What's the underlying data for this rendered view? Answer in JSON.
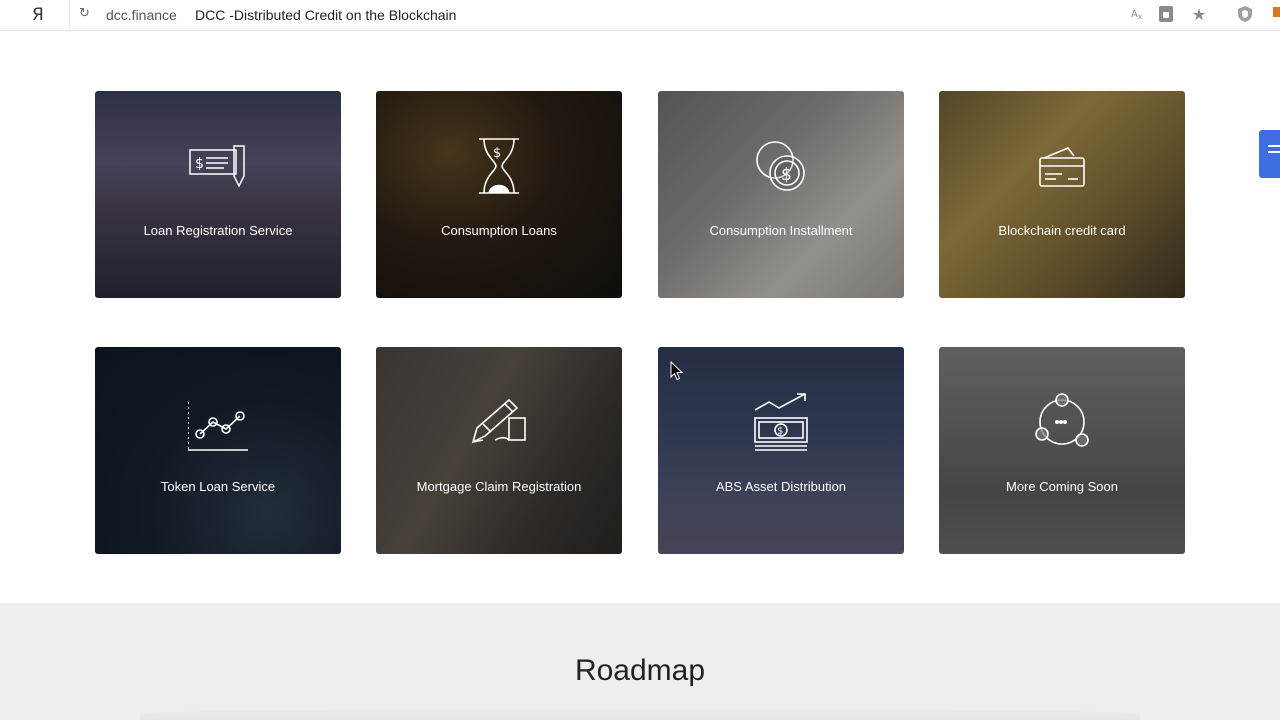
{
  "browser": {
    "logo": "Я",
    "domain": "dcc.finance",
    "title": "DCC -Distributed Credit on the Blockchain",
    "icons": [
      "reload-icon",
      "translate-icon",
      "lock-icon",
      "star-icon",
      "shield-icon"
    ]
  },
  "services": [
    {
      "label": "Loan Registration Service",
      "icon": "cheque-icon"
    },
    {
      "label": "Consumption Loans",
      "icon": "hourglass-dollar-icon"
    },
    {
      "label": "Consumption Installment",
      "icon": "coins-icon"
    },
    {
      "label": "Blockchain credit card",
      "icon": "credit-card-icon"
    },
    {
      "label": "Token Loan Service",
      "icon": "line-chart-icon"
    },
    {
      "label": "Mortgage Claim Registration",
      "icon": "pen-contract-icon"
    },
    {
      "label": "ABS Asset Distribution",
      "icon": "money-growth-icon"
    },
    {
      "label": "More Coming Soon",
      "icon": "network-icon"
    }
  ],
  "roadmap": {
    "title": "Roadmap"
  },
  "colors": {
    "side_button": "#3d6de0",
    "section_bg": "#eeeeee"
  }
}
